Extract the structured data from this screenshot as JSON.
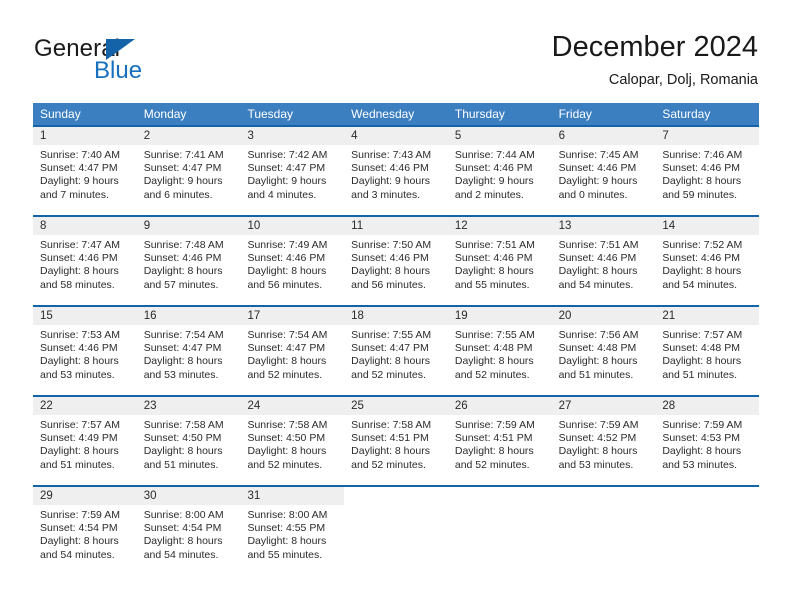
{
  "brand": {
    "name_part1": "General",
    "name_part2": "Blue",
    "flag_icon": "brand-flag-icon",
    "accent_color": "#1463a8",
    "blue_text_color": "#1670bf"
  },
  "header": {
    "title": "December 2024",
    "subtitle": "Calopar, Dolj, Romania"
  },
  "calendar": {
    "header_bg": "#3c7fc1",
    "row_divider_color": "#1463a8",
    "date_band_bg": "#efefef",
    "weekdays": [
      "Sunday",
      "Monday",
      "Tuesday",
      "Wednesday",
      "Thursday",
      "Friday",
      "Saturday"
    ],
    "weeks": [
      [
        {
          "day": "1",
          "sunrise": "Sunrise: 7:40 AM",
          "sunset": "Sunset: 4:47 PM",
          "daylight_line1": "Daylight: 9 hours",
          "daylight_line2": "and 7 minutes."
        },
        {
          "day": "2",
          "sunrise": "Sunrise: 7:41 AM",
          "sunset": "Sunset: 4:47 PM",
          "daylight_line1": "Daylight: 9 hours",
          "daylight_line2": "and 6 minutes."
        },
        {
          "day": "3",
          "sunrise": "Sunrise: 7:42 AM",
          "sunset": "Sunset: 4:47 PM",
          "daylight_line1": "Daylight: 9 hours",
          "daylight_line2": "and 4 minutes."
        },
        {
          "day": "4",
          "sunrise": "Sunrise: 7:43 AM",
          "sunset": "Sunset: 4:46 PM",
          "daylight_line1": "Daylight: 9 hours",
          "daylight_line2": "and 3 minutes."
        },
        {
          "day": "5",
          "sunrise": "Sunrise: 7:44 AM",
          "sunset": "Sunset: 4:46 PM",
          "daylight_line1": "Daylight: 9 hours",
          "daylight_line2": "and 2 minutes."
        },
        {
          "day": "6",
          "sunrise": "Sunrise: 7:45 AM",
          "sunset": "Sunset: 4:46 PM",
          "daylight_line1": "Daylight: 9 hours",
          "daylight_line2": "and 0 minutes."
        },
        {
          "day": "7",
          "sunrise": "Sunrise: 7:46 AM",
          "sunset": "Sunset: 4:46 PM",
          "daylight_line1": "Daylight: 8 hours",
          "daylight_line2": "and 59 minutes."
        }
      ],
      [
        {
          "day": "8",
          "sunrise": "Sunrise: 7:47 AM",
          "sunset": "Sunset: 4:46 PM",
          "daylight_line1": "Daylight: 8 hours",
          "daylight_line2": "and 58 minutes."
        },
        {
          "day": "9",
          "sunrise": "Sunrise: 7:48 AM",
          "sunset": "Sunset: 4:46 PM",
          "daylight_line1": "Daylight: 8 hours",
          "daylight_line2": "and 57 minutes."
        },
        {
          "day": "10",
          "sunrise": "Sunrise: 7:49 AM",
          "sunset": "Sunset: 4:46 PM",
          "daylight_line1": "Daylight: 8 hours",
          "daylight_line2": "and 56 minutes."
        },
        {
          "day": "11",
          "sunrise": "Sunrise: 7:50 AM",
          "sunset": "Sunset: 4:46 PM",
          "daylight_line1": "Daylight: 8 hours",
          "daylight_line2": "and 56 minutes."
        },
        {
          "day": "12",
          "sunrise": "Sunrise: 7:51 AM",
          "sunset": "Sunset: 4:46 PM",
          "daylight_line1": "Daylight: 8 hours",
          "daylight_line2": "and 55 minutes."
        },
        {
          "day": "13",
          "sunrise": "Sunrise: 7:51 AM",
          "sunset": "Sunset: 4:46 PM",
          "daylight_line1": "Daylight: 8 hours",
          "daylight_line2": "and 54 minutes."
        },
        {
          "day": "14",
          "sunrise": "Sunrise: 7:52 AM",
          "sunset": "Sunset: 4:46 PM",
          "daylight_line1": "Daylight: 8 hours",
          "daylight_line2": "and 54 minutes."
        }
      ],
      [
        {
          "day": "15",
          "sunrise": "Sunrise: 7:53 AM",
          "sunset": "Sunset: 4:46 PM",
          "daylight_line1": "Daylight: 8 hours",
          "daylight_line2": "and 53 minutes."
        },
        {
          "day": "16",
          "sunrise": "Sunrise: 7:54 AM",
          "sunset": "Sunset: 4:47 PM",
          "daylight_line1": "Daylight: 8 hours",
          "daylight_line2": "and 53 minutes."
        },
        {
          "day": "17",
          "sunrise": "Sunrise: 7:54 AM",
          "sunset": "Sunset: 4:47 PM",
          "daylight_line1": "Daylight: 8 hours",
          "daylight_line2": "and 52 minutes."
        },
        {
          "day": "18",
          "sunrise": "Sunrise: 7:55 AM",
          "sunset": "Sunset: 4:47 PM",
          "daylight_line1": "Daylight: 8 hours",
          "daylight_line2": "and 52 minutes."
        },
        {
          "day": "19",
          "sunrise": "Sunrise: 7:55 AM",
          "sunset": "Sunset: 4:48 PM",
          "daylight_line1": "Daylight: 8 hours",
          "daylight_line2": "and 52 minutes."
        },
        {
          "day": "20",
          "sunrise": "Sunrise: 7:56 AM",
          "sunset": "Sunset: 4:48 PM",
          "daylight_line1": "Daylight: 8 hours",
          "daylight_line2": "and 51 minutes."
        },
        {
          "day": "21",
          "sunrise": "Sunrise: 7:57 AM",
          "sunset": "Sunset: 4:48 PM",
          "daylight_line1": "Daylight: 8 hours",
          "daylight_line2": "and 51 minutes."
        }
      ],
      [
        {
          "day": "22",
          "sunrise": "Sunrise: 7:57 AM",
          "sunset": "Sunset: 4:49 PM",
          "daylight_line1": "Daylight: 8 hours",
          "daylight_line2": "and 51 minutes."
        },
        {
          "day": "23",
          "sunrise": "Sunrise: 7:58 AM",
          "sunset": "Sunset: 4:50 PM",
          "daylight_line1": "Daylight: 8 hours",
          "daylight_line2": "and 51 minutes."
        },
        {
          "day": "24",
          "sunrise": "Sunrise: 7:58 AM",
          "sunset": "Sunset: 4:50 PM",
          "daylight_line1": "Daylight: 8 hours",
          "daylight_line2": "and 52 minutes."
        },
        {
          "day": "25",
          "sunrise": "Sunrise: 7:58 AM",
          "sunset": "Sunset: 4:51 PM",
          "daylight_line1": "Daylight: 8 hours",
          "daylight_line2": "and 52 minutes."
        },
        {
          "day": "26",
          "sunrise": "Sunrise: 7:59 AM",
          "sunset": "Sunset: 4:51 PM",
          "daylight_line1": "Daylight: 8 hours",
          "daylight_line2": "and 52 minutes."
        },
        {
          "day": "27",
          "sunrise": "Sunrise: 7:59 AM",
          "sunset": "Sunset: 4:52 PM",
          "daylight_line1": "Daylight: 8 hours",
          "daylight_line2": "and 53 minutes."
        },
        {
          "day": "28",
          "sunrise": "Sunrise: 7:59 AM",
          "sunset": "Sunset: 4:53 PM",
          "daylight_line1": "Daylight: 8 hours",
          "daylight_line2": "and 53 minutes."
        }
      ],
      [
        {
          "day": "29",
          "sunrise": "Sunrise: 7:59 AM",
          "sunset": "Sunset: 4:54 PM",
          "daylight_line1": "Daylight: 8 hours",
          "daylight_line2": "and 54 minutes."
        },
        {
          "day": "30",
          "sunrise": "Sunrise: 8:00 AM",
          "sunset": "Sunset: 4:54 PM",
          "daylight_line1": "Daylight: 8 hours",
          "daylight_line2": "and 54 minutes."
        },
        {
          "day": "31",
          "sunrise": "Sunrise: 8:00 AM",
          "sunset": "Sunset: 4:55 PM",
          "daylight_line1": "Daylight: 8 hours",
          "daylight_line2": "and 55 minutes."
        },
        {
          "day": "",
          "sunrise": "",
          "sunset": "",
          "daylight_line1": "",
          "daylight_line2": ""
        },
        {
          "day": "",
          "sunrise": "",
          "sunset": "",
          "daylight_line1": "",
          "daylight_line2": ""
        },
        {
          "day": "",
          "sunrise": "",
          "sunset": "",
          "daylight_line1": "",
          "daylight_line2": ""
        },
        {
          "day": "",
          "sunrise": "",
          "sunset": "",
          "daylight_line1": "",
          "daylight_line2": ""
        }
      ]
    ]
  }
}
